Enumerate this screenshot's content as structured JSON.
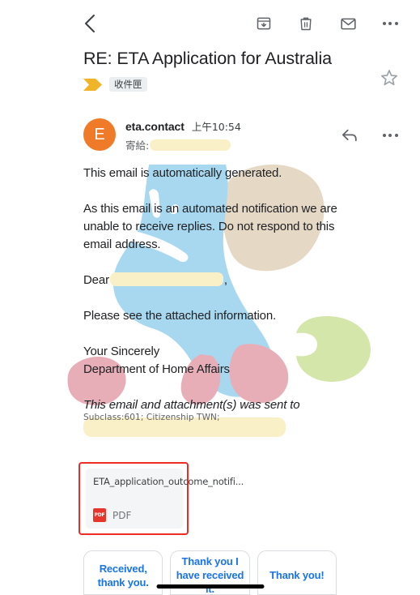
{
  "toolbar": {
    "back": "back-arrow",
    "archive": "archive-icon",
    "delete": "trash-icon",
    "unread": "mail-icon",
    "more": "more-options-icon"
  },
  "header": {
    "subject": "RE: ETA Application for Australia",
    "label_chip": "收件匣",
    "label_arrow_color": "#f0b429",
    "star": "star-outline-icon"
  },
  "sender": {
    "avatar_initial": "E",
    "avatar_color": "#ef7b28",
    "name": "eta.contact",
    "time": "上午10:54",
    "to_label": "寄給:",
    "to_value": "",
    "reply": "reply-arrow-icon",
    "more": "more-options-icon"
  },
  "body": {
    "p1": "This email is automatically generated.",
    "p2": "As this email is an automated notification we are unable to receive replies. Do not respond to this email address.",
    "dear_prefix": "Dear",
    "dear_suffix": ",",
    "p3": "Please see the attached information.",
    "sign_off_1": "Your Sincerely",
    "sign_off_2": "Department of Home Affairs",
    "p4_italic": "This email and attachment(s) was sent to",
    "fineprint": "Subclass:601; Citizenship TWN;"
  },
  "attachment": {
    "filename": "ETA_application_outcome_notifi...",
    "type_label": "PDF",
    "icon_label": "PDF",
    "icon_color": "#e8352c",
    "highlight_color": "#ee2b24"
  },
  "smart_replies": [
    {
      "label": "Received, thank you."
    },
    {
      "label": "Thank you I have received it."
    },
    {
      "label": "Thank you!"
    }
  ],
  "colors": {
    "accent_blue": "#1a73e8",
    "redaction": "#faf0c8",
    "watermark_blue": "#a8d8ef",
    "watermark_beige": "#e5d9c6",
    "watermark_green": "#d5e6ab",
    "watermark_pink": "#e8aeb7"
  }
}
